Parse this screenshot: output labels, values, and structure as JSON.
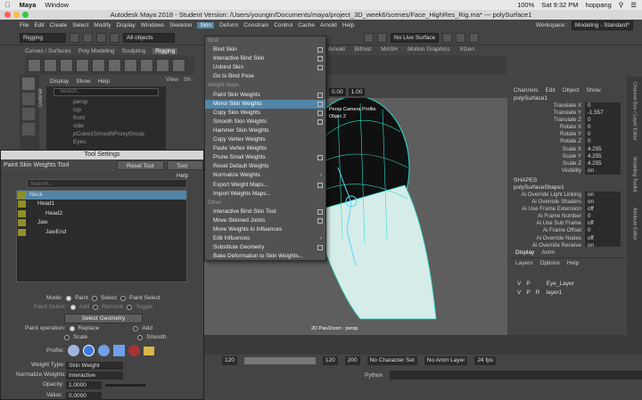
{
  "macbar": {
    "app": "Maya",
    "menu_window": "Window",
    "battery": "100%",
    "time": "Sat 9:32 PM",
    "user": "hoppang"
  },
  "window_title": "Autodesk Maya 2018 - Student Version: /Users/youngin/Documents/maya/project_3D_week6/scenes/Face_HighRes_Rig.ma*   ---   polySurface1",
  "menubar": {
    "items": [
      "File",
      "Edit",
      "Create",
      "Select",
      "Modify",
      "Display",
      "Windows",
      "Skeleton",
      "Skin",
      "Deform",
      "Constrain",
      "Control",
      "Cache",
      "Arnold",
      "Help"
    ],
    "workspace_label": "Workspace :",
    "workspace_value": "Modeling - Standard*"
  },
  "status": {
    "mode": "Rigging",
    "objects": "All objects",
    "live": "No Live Surface"
  },
  "shelf_tabs": [
    "Curves / Surfaces",
    "Poly Modeling",
    "Sculpting",
    "Rigging"
  ],
  "shelf_tabs_right": [
    "Arnold",
    "Bifrost",
    "MASH",
    "Motion Graphics",
    "XGen"
  ],
  "outliner": {
    "tab": "Outliner",
    "menu": [
      "Display",
      "Show",
      "Help"
    ],
    "search": "Search...",
    "rows": [
      "persp",
      "top",
      "front",
      "side",
      "pCube1SmoothProxyGroup",
      "Eyes"
    ]
  },
  "panel_menu": [
    "View",
    "Sh"
  ],
  "viewport": {
    "field1": "0.00",
    "field2": "1.00",
    "label_top": "Persp Camera Profile",
    "label_obj": "Objec 2",
    "camera": "2D Pan/Zoom : persp"
  },
  "skin_menu": {
    "items": [
      {
        "t": "Bind",
        "sec": true
      },
      {
        "t": "Bind Skin",
        "ob": true
      },
      {
        "t": "Interactive Bind Skin",
        "ob": true
      },
      {
        "t": "Unbind Skin",
        "ob": true
      },
      {
        "t": "Go to Bind Pose"
      },
      {
        "t": "Weight Maps",
        "sec": true
      },
      {
        "t": "Paint Skin Weights",
        "ob": true
      },
      {
        "t": "Mirror Skin Weights",
        "ob": true,
        "hl": true
      },
      {
        "t": "Copy Skin Weights",
        "ob": true
      },
      {
        "t": "Smooth Skin Weights",
        "ob": true
      },
      {
        "t": "Hammer Skin Weights"
      },
      {
        "t": "Copy Vertex Weights"
      },
      {
        "t": "Paste Vertex Weights"
      },
      {
        "t": "Prune Small Weights",
        "ob": true
      },
      {
        "t": "Reset Default Weights"
      },
      {
        "t": "Normalize Weights",
        "ar": true
      },
      {
        "t": "Export Weight Maps...",
        "ob": true
      },
      {
        "t": "Import Weights Maps..."
      },
      {
        "t": "Other",
        "sec": true
      },
      {
        "t": "Interactive Bind Skin Tool",
        "ob": true
      },
      {
        "t": "Move Skinned Joints",
        "ob": true
      },
      {
        "t": "Move Weights to Influences"
      },
      {
        "t": "Edit Influences",
        "ar": true
      },
      {
        "t": "Substitute Geometry",
        "ob": true
      },
      {
        "t": "Bake Deformation to Skin Weights..."
      }
    ]
  },
  "channel_box": {
    "tabs": [
      "Channels",
      "Edit",
      "Object",
      "Show"
    ],
    "object": "polySurface1",
    "attrs": [
      {
        "l": "Translate X",
        "v": "0"
      },
      {
        "l": "Translate Y",
        "v": "-1.557"
      },
      {
        "l": "Translate Z",
        "v": "0"
      },
      {
        "l": "Rotate X",
        "v": "0"
      },
      {
        "l": "Rotate Y",
        "v": "0"
      },
      {
        "l": "Rotate Z",
        "v": "0"
      },
      {
        "l": "Scale X",
        "v": "4.255"
      },
      {
        "l": "Scale Y",
        "v": "4.255"
      },
      {
        "l": "Scale Z",
        "v": "4.255"
      },
      {
        "l": "Visibility",
        "v": "on"
      }
    ],
    "shapes_label": "SHAPES",
    "shape": "polySurfaceShape1",
    "shape_attrs": [
      {
        "l": "Ai Override Light Linking",
        "v": "on"
      },
      {
        "l": "Ai Override Shaders",
        "v": "on"
      },
      {
        "l": "Ai Use Frame Extension",
        "v": "off"
      },
      {
        "l": "Ai Frame Number",
        "v": "0"
      },
      {
        "l": "Ai Use Sub Frame",
        "v": "off"
      },
      {
        "l": "Ai Frame Offset",
        "v": "0"
      },
      {
        "l": "Ai Override Nodes",
        "v": "off"
      },
      {
        "l": "Ai Override Receive Shadows",
        "v": "on"
      }
    ]
  },
  "layers": {
    "tabs": [
      "Display",
      "Anim"
    ],
    "menu": [
      "Layers",
      "Options",
      "Help"
    ],
    "rows": [
      {
        "v": "V",
        "p": "P",
        "r": "",
        "name": "Eye_Layer"
      },
      {
        "v": "V",
        "p": "P",
        "r": "R",
        "name": "layer1"
      }
    ]
  },
  "vert_tabs": [
    "Channel Box / Layer Editor",
    "Modeling Toolkit",
    "Attribute Editor"
  ],
  "range": {
    "start": "120",
    "cur1": "120",
    "end": "200",
    "char": "No Character Set",
    "anim": "No Anim Layer",
    "fps": "24 fps"
  },
  "python": "Python",
  "tool_settings": {
    "title": "Tool Settings",
    "tool": "Paint Skin Weights Tool",
    "reset": "Reset Tool",
    "help": "Tool Help",
    "search": "Search...",
    "joints": [
      {
        "n": "Neck",
        "lvl": 0,
        "sel": true
      },
      {
        "n": "Head1",
        "lvl": 1
      },
      {
        "n": "Head2",
        "lvl": 2
      },
      {
        "n": "Jaw",
        "lvl": 1
      },
      {
        "n": "JawEnd",
        "lvl": 2
      }
    ],
    "mode_label": "Mode:",
    "mode_opts": [
      "Paint",
      "Select",
      "Paint Select"
    ],
    "paint_select_label": "Paint Select:",
    "ps_opts": [
      "Add",
      "Remove",
      "Toggle"
    ],
    "select_geometry": "Select Geometry",
    "paint_op_label": "Paint operation:",
    "op_opts": [
      "Replace",
      "Add",
      "Scale",
      "Smooth"
    ],
    "profile_label": "Profile:",
    "weight_type_label": "Weight Type:",
    "weight_type": "Skin Weight",
    "normalize_label": "Normalize Weights:",
    "normalize": "Interactive",
    "opacity_label": "Opacity:",
    "opacity": "1.0000",
    "value_label": "Value:",
    "value": "0.0000"
  }
}
